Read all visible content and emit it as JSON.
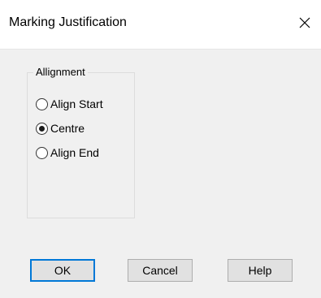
{
  "window": {
    "title": "Marking Justification",
    "close_icon": "close-icon"
  },
  "group": {
    "label": "Allignment",
    "options": [
      {
        "label": "Align Start",
        "selected": false
      },
      {
        "label": "Centre",
        "selected": true
      },
      {
        "label": "Align End",
        "selected": false
      }
    ]
  },
  "buttons": {
    "ok": "OK",
    "cancel": "Cancel",
    "help": "Help"
  },
  "colors": {
    "default_button_border": "#0078d7",
    "client_background": "#f0f0f0"
  }
}
